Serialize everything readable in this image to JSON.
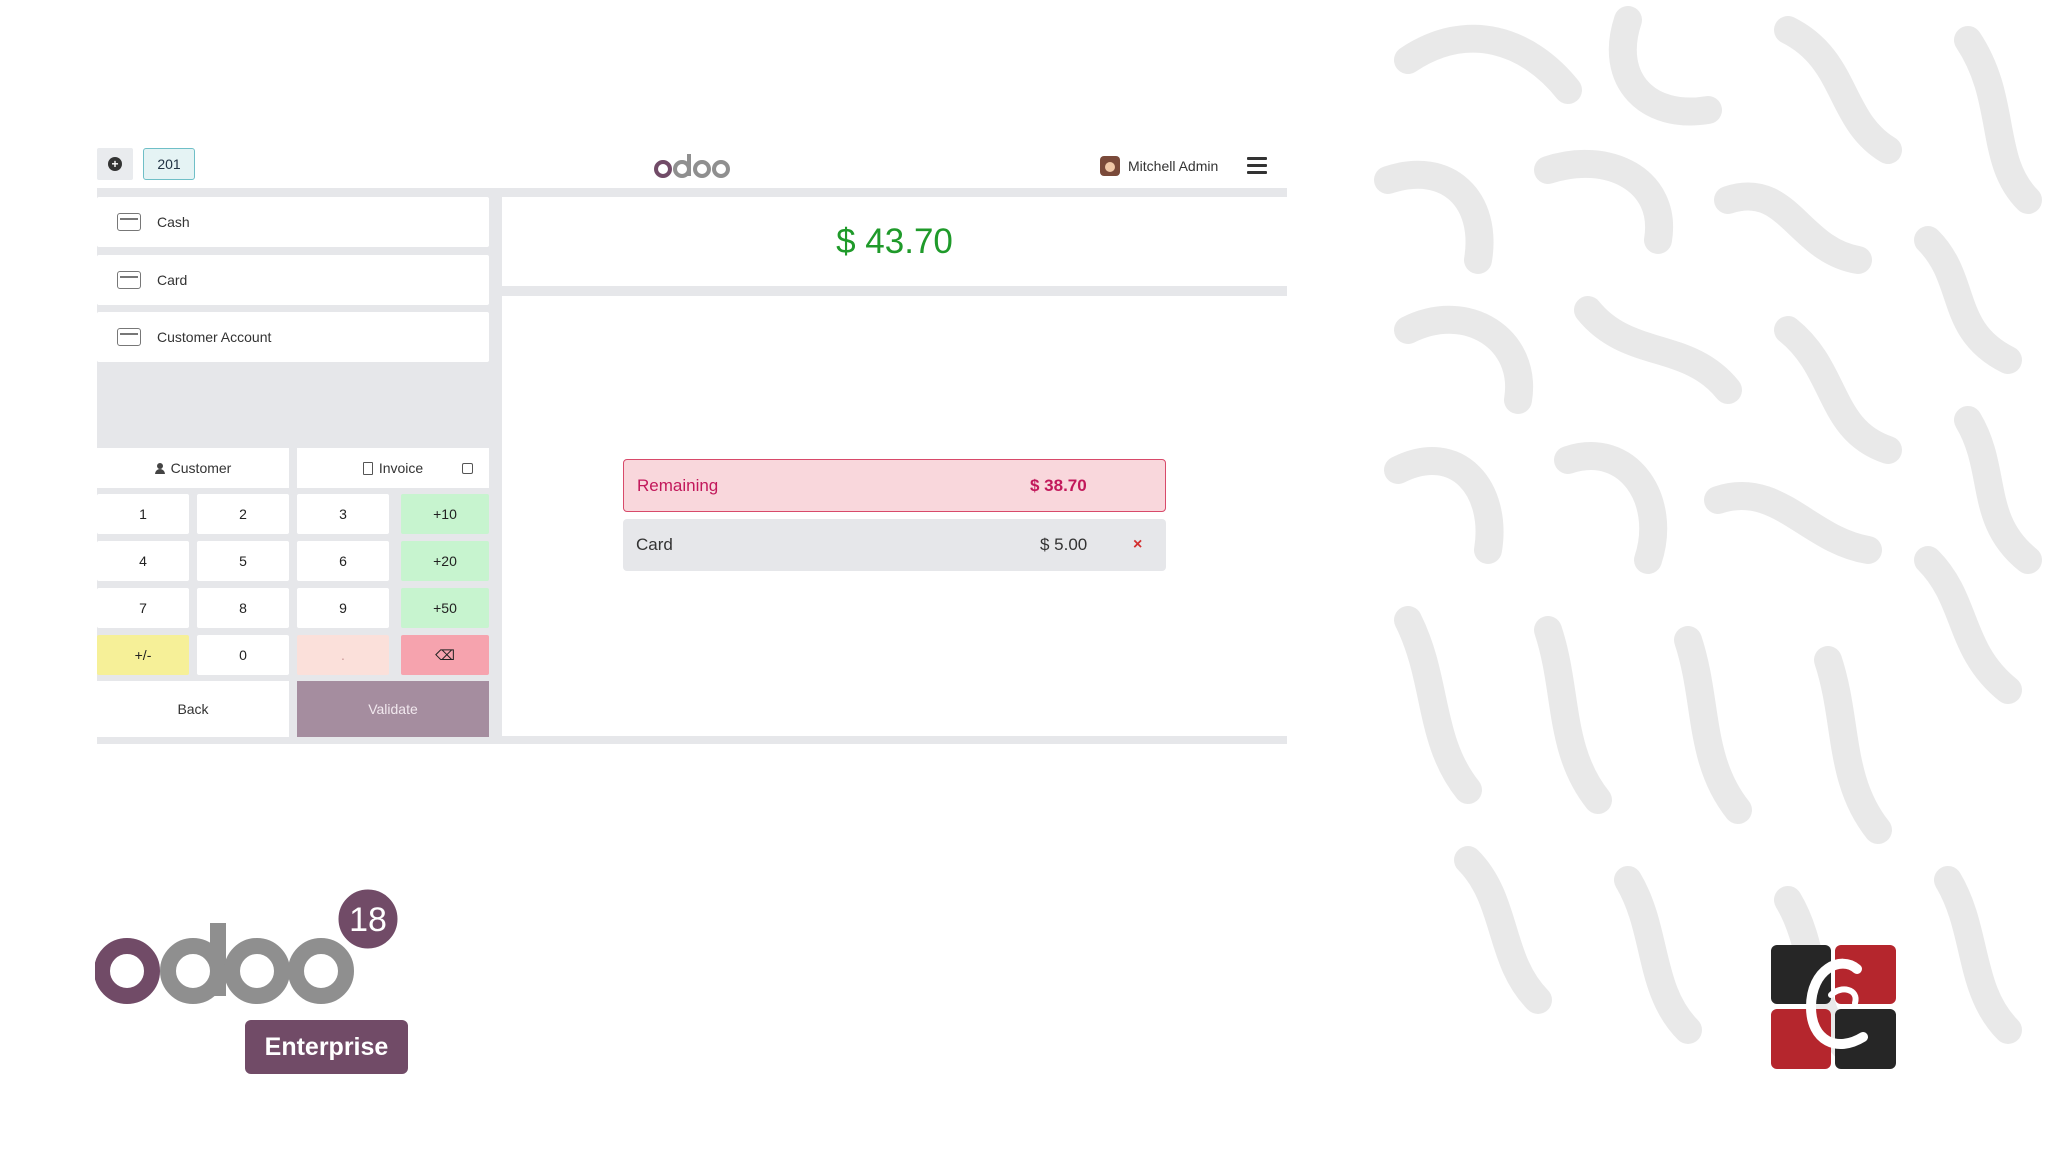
{
  "topbar": {
    "order_tab": "201",
    "user_name": "Mitchell Admin"
  },
  "payment_methods": [
    {
      "label": "Cash",
      "icon": "cash-icon"
    },
    {
      "label": "Card",
      "icon": "card-icon"
    },
    {
      "label": "Customer Account",
      "icon": "customer-account-icon"
    }
  ],
  "summary": {
    "total": "$ 43.70",
    "remaining_label": "Remaining",
    "remaining_amount": "$ 38.70"
  },
  "payment_lines": [
    {
      "method": "Card",
      "amount": "$ 5.00",
      "remove": "×"
    }
  ],
  "actions": {
    "customer": "Customer",
    "invoice": "Invoice",
    "back": "Back",
    "validate": "Validate"
  },
  "numpad": {
    "row1": [
      "1",
      "2",
      "3",
      "+10"
    ],
    "row2": [
      "4",
      "5",
      "6",
      "+20"
    ],
    "row3": [
      "7",
      "8",
      "9",
      "+50"
    ],
    "row4": [
      "+/-",
      "0",
      ".",
      "⌫"
    ]
  },
  "branding": {
    "version": "18",
    "edition": "Enterprise"
  },
  "colors": {
    "brand": "#714b67",
    "total_green": "#1f9a2a",
    "remaining_red": "#c2185b",
    "quick_add_green": "#c7f4cf",
    "validate_disabled": "#a58d9f"
  }
}
